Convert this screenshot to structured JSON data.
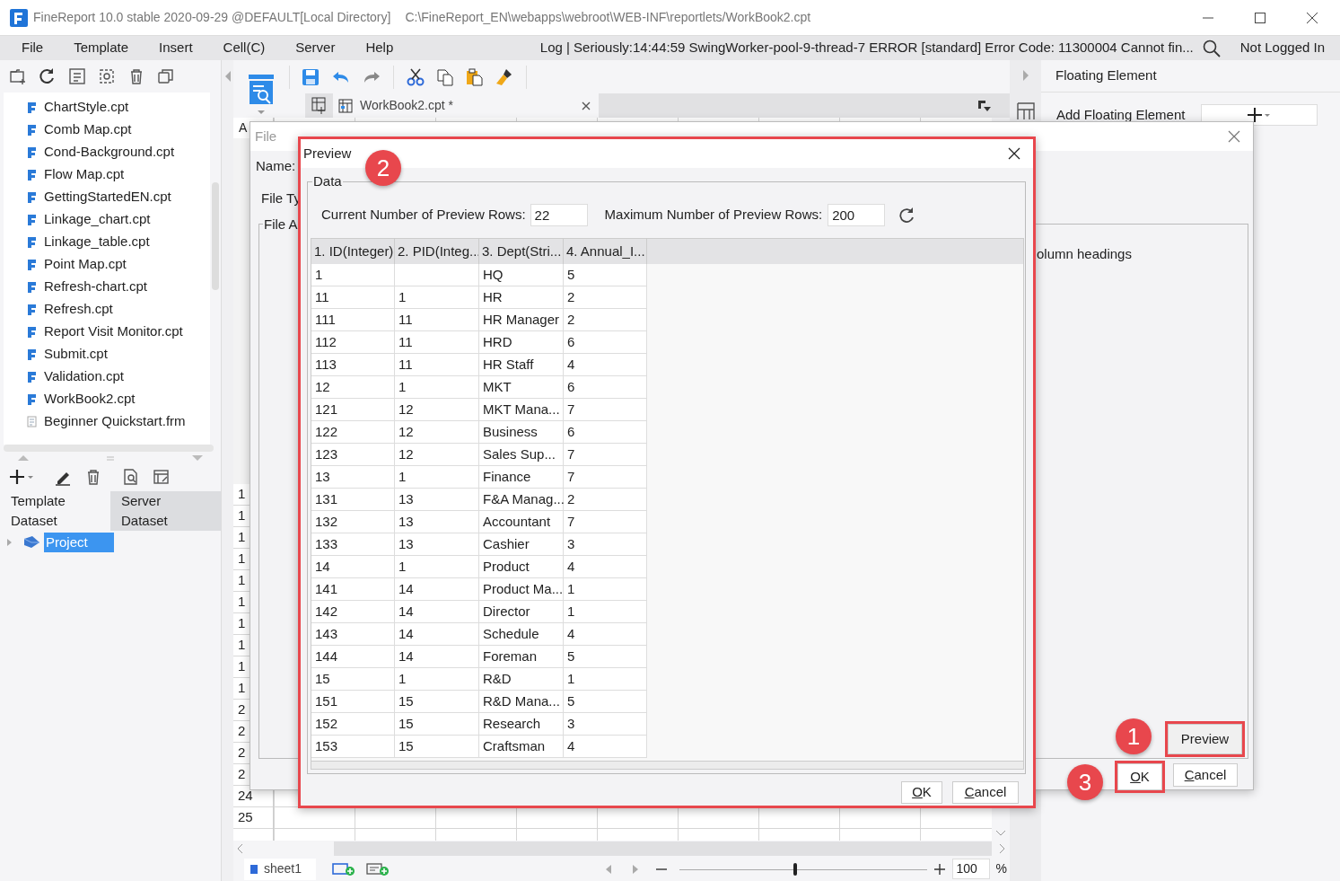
{
  "window": {
    "title": "FineReport 10.0 stable 2020-09-29 @DEFAULT[Local Directory]",
    "path": "C:\\FineReport_EN\\webapps\\webroot\\WEB-INF\\reportlets/WorkBook2.cpt"
  },
  "menu": [
    "File",
    "Template",
    "Insert",
    "Cell(C)",
    "Server",
    "Help"
  ],
  "log": "Log | Seriously:14:44:59 SwingWorker-pool-9-thread-7 ERROR [standard] Error Code: 11300004 Cannot fin...",
  "user": "Not Logged In",
  "file_list": [
    {
      "label": "ChartStyle.cpt",
      "kind": "cpt"
    },
    {
      "label": "Comb Map.cpt",
      "kind": "cpt"
    },
    {
      "label": "Cond-Background.cpt",
      "kind": "cpt"
    },
    {
      "label": "Flow Map.cpt",
      "kind": "cpt"
    },
    {
      "label": "GettingStartedEN.cpt",
      "kind": "cpt"
    },
    {
      "label": "Linkage_chart.cpt",
      "kind": "cpt"
    },
    {
      "label": "Linkage_table.cpt",
      "kind": "cpt"
    },
    {
      "label": "Point Map.cpt",
      "kind": "cpt"
    },
    {
      "label": "Refresh-chart.cpt",
      "kind": "cpt"
    },
    {
      "label": "Refresh.cpt",
      "kind": "cpt"
    },
    {
      "label": "Report Visit Monitor.cpt",
      "kind": "cpt"
    },
    {
      "label": "Submit.cpt",
      "kind": "cpt"
    },
    {
      "label": "Validation.cpt",
      "kind": "cpt"
    },
    {
      "label": "WorkBook2.cpt",
      "kind": "cpt"
    },
    {
      "label": "Beginner Quickstart.frm",
      "kind": "frm"
    }
  ],
  "dataset_tabs": [
    {
      "label": "Template Dataset",
      "selected": true
    },
    {
      "label": "Server Dataset",
      "selected": false
    }
  ],
  "dataset_tree": [
    {
      "label": "Project",
      "selected": true,
      "expanded": false
    }
  ],
  "editor_tab": {
    "label": "WorkBook2.cpt *"
  },
  "sheet": {
    "column_1": "A",
    "row_labels": [
      "1",
      "1",
      "1",
      "1",
      "1",
      "1",
      "1",
      "1",
      "1",
      "1",
      "2",
      "2",
      "2",
      "2",
      "24",
      "25"
    ]
  },
  "sheet_tabs": [
    {
      "label": "sheet1"
    }
  ],
  "zoom": {
    "value": "100",
    "unit": "%",
    "level": 0.47
  },
  "right_panel": {
    "title": "Floating Element",
    "add_label": "Add Floating Element"
  },
  "file_dialog": {
    "title": "File",
    "name_label": "Name:",
    "type_label": "File Ty",
    "group": "File A",
    "note": "olumn headings",
    "preview": "Preview",
    "ok": "OK",
    "cancel": "Cancel"
  },
  "preview_dialog": {
    "title": "Preview",
    "group": "Data",
    "current_label": "Current Number of Preview Rows:",
    "current_value": "22",
    "max_label": "Maximum Number of Preview Rows:",
    "max_value": "200",
    "columns": [
      "1. ID(Integer)",
      "2. PID(Integ...",
      "3. Dept(Stri...",
      "4. Annual_I..."
    ],
    "rows": [
      {
        "id": "1",
        "dept": "HQ",
        "value": "5"
      },
      {
        "id": "11",
        "pid": "1",
        "dept": "HR",
        "value": "2"
      },
      {
        "id": "111",
        "pid": "11",
        "dept": "HR Manager",
        "value": "2"
      },
      {
        "id": "112",
        "pid": "11",
        "dept": "HRD",
        "value": "6"
      },
      {
        "id": "113",
        "pid": "11",
        "dept": "HR Staff",
        "value": "4"
      },
      {
        "id": "12",
        "pid": "1",
        "dept": "MKT",
        "value": "6"
      },
      {
        "id": "121",
        "pid": "12",
        "dept": "MKT Mana...",
        "value": "7"
      },
      {
        "id": "122",
        "pid": "12",
        "dept": "Business",
        "value": "6"
      },
      {
        "id": "123",
        "pid": "12",
        "dept": "Sales Sup...",
        "value": "7"
      },
      {
        "id": "13",
        "pid": "1",
        "dept": "Finance",
        "value": "7"
      },
      {
        "id": "131",
        "pid": "13",
        "dept": "F&A Manag...",
        "value": "2"
      },
      {
        "id": "132",
        "pid": "13",
        "dept": "Accountant",
        "value": "7"
      },
      {
        "id": "133",
        "pid": "13",
        "dept": "Cashier",
        "value": "3"
      },
      {
        "id": "14",
        "pid": "1",
        "dept": "Product",
        "value": "4"
      },
      {
        "id": "141",
        "pid": "14",
        "dept": "Product Ma...",
        "value": "1"
      },
      {
        "id": "142",
        "pid": "14",
        "dept": "Director",
        "value": "1"
      },
      {
        "id": "143",
        "pid": "14",
        "dept": "Schedule",
        "value": "4"
      },
      {
        "id": "144",
        "pid": "14",
        "dept": "Foreman",
        "value": "5"
      },
      {
        "id": "15",
        "pid": "1",
        "dept": "R&D",
        "value": "1"
      },
      {
        "id": "151",
        "pid": "15",
        "dept": "R&D Mana...",
        "value": "5"
      },
      {
        "id": "152",
        "pid": "15",
        "dept": "Research",
        "value": "3"
      },
      {
        "id": "153",
        "pid": "15",
        "dept": "Craftsman",
        "value": "4"
      }
    ],
    "ok": "OK",
    "cancel": "Cancel"
  },
  "callouts": [
    "1",
    "2",
    "3"
  ]
}
